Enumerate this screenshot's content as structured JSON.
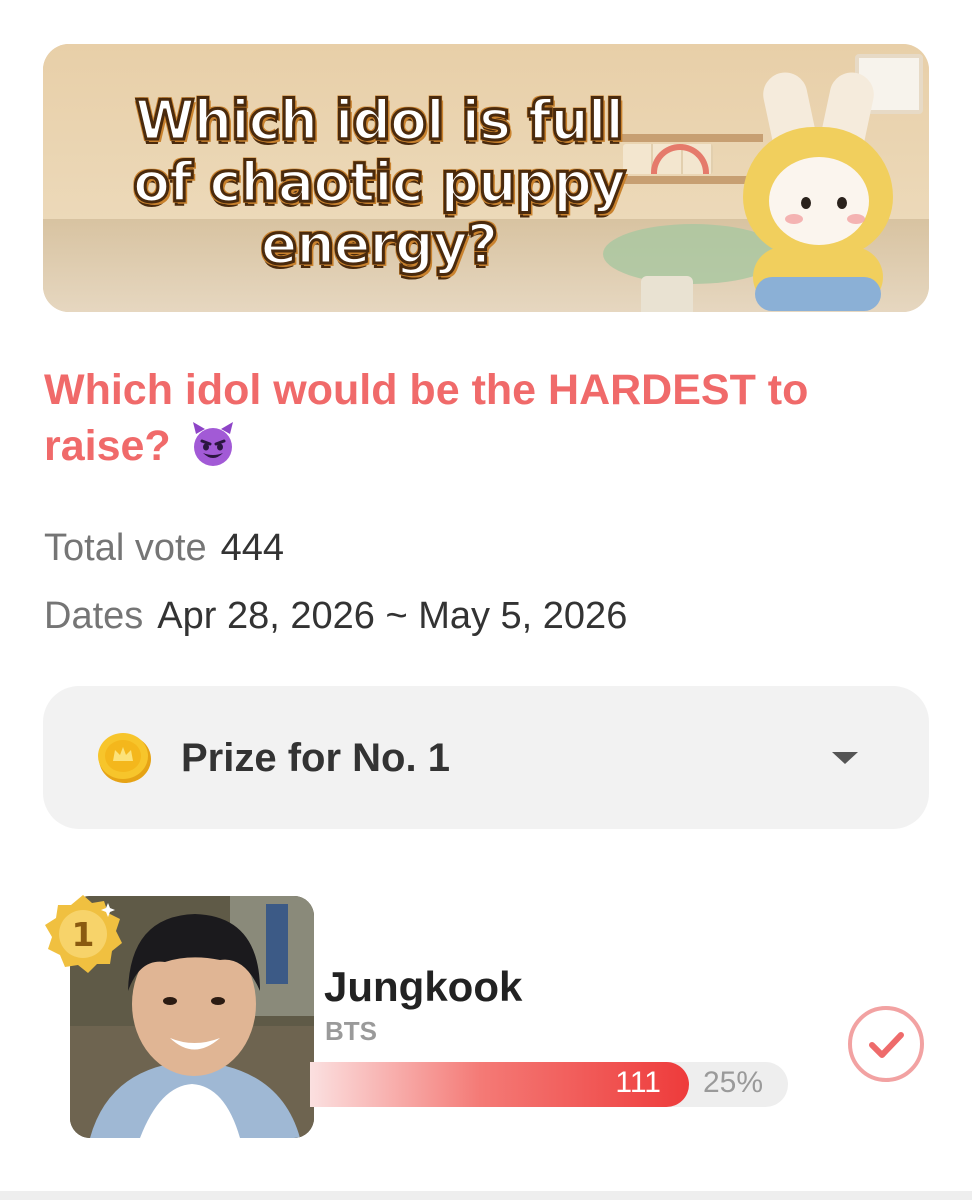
{
  "banner": {
    "title": "Which idol is full of chaotic puppy energy?"
  },
  "question": {
    "text": "Which idol would be the HARDEST to raise?",
    "emoji_icon": "smiling-devil-emoji-icon"
  },
  "stats": {
    "total_label": "Total vote",
    "total_value": "444",
    "dates_label": "Dates",
    "dates_value": "Apr 28, 2026 ~ May 5, 2026"
  },
  "prize": {
    "label": "Prize for No. 1",
    "icon": "gold-coin-icon",
    "toggle_icon": "chevron-down-icon"
  },
  "entries": [
    {
      "rank": "1",
      "name": "Jungkook",
      "group": "BTS",
      "votes": "111",
      "percent_label": "25%",
      "percent": 25
    }
  ],
  "colors": {
    "accent": "#f06a6a",
    "bar_end": "#ee3b3b",
    "check": "#f08a8a"
  }
}
